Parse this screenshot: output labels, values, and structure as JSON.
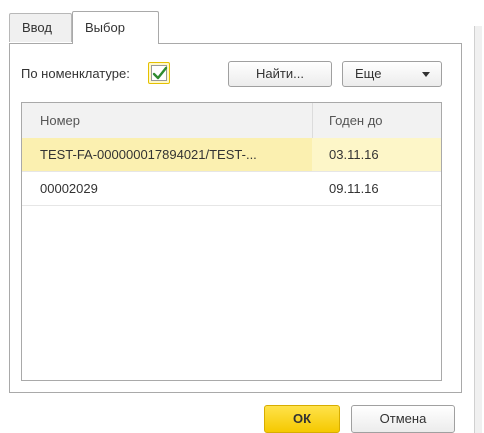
{
  "tabs": [
    {
      "label": "Ввод",
      "active": false
    },
    {
      "label": "Выбор",
      "active": true
    }
  ],
  "filter": {
    "label": "По номенклатуре:",
    "checked": true
  },
  "toolbar": {
    "find_label": "Найти...",
    "more_label": "Еще"
  },
  "table": {
    "columns": [
      "Номер",
      "Годен до"
    ],
    "rows": [
      {
        "number": "TEST-FA-000000017894021/TEST-...",
        "expiry": "03.11.16",
        "selected": true
      },
      {
        "number": "00002029",
        "expiry": "09.11.16",
        "selected": false
      }
    ]
  },
  "footer": {
    "ok_label": "ОК",
    "cancel_label": "Отмена"
  },
  "colors": {
    "accent": "#f5c900",
    "selected_row": "#fbf0b0",
    "check": "#2e8b2e"
  }
}
